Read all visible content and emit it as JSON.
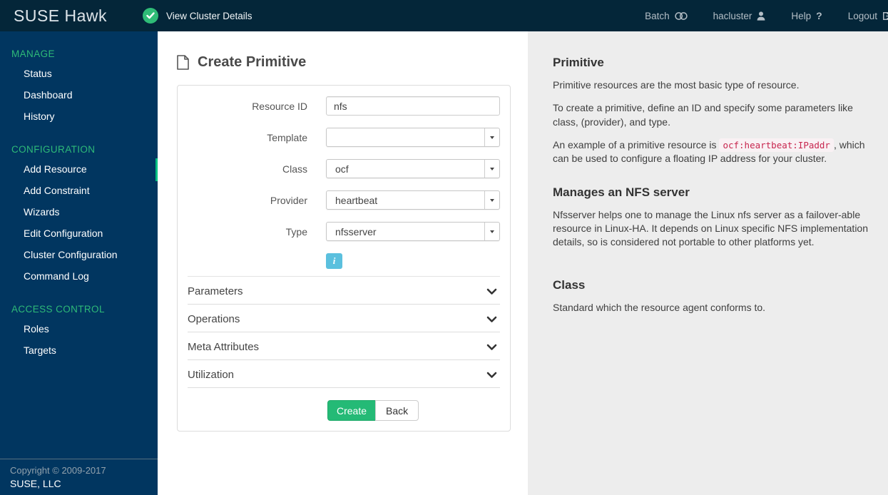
{
  "topbar": {
    "brand": "SUSE Hawk",
    "cluster_status_label": "View Cluster Details",
    "batch_label": "Batch",
    "user_label": "hacluster",
    "help_label": "Help",
    "logout_label": "Logout"
  },
  "sidebar": {
    "sections": [
      {
        "header": "MANAGE",
        "items": [
          {
            "label": "Status"
          },
          {
            "label": "Dashboard"
          },
          {
            "label": "History"
          }
        ]
      },
      {
        "header": "CONFIGURATION",
        "items": [
          {
            "label": "Add Resource",
            "active": true
          },
          {
            "label": "Add Constraint"
          },
          {
            "label": "Wizards"
          },
          {
            "label": "Edit Configuration"
          },
          {
            "label": "Cluster Configuration"
          },
          {
            "label": "Command Log"
          }
        ]
      },
      {
        "header": "ACCESS CONTROL",
        "items": [
          {
            "label": "Roles"
          },
          {
            "label": "Targets"
          }
        ]
      }
    ],
    "copyright": "Copyright © 2009-2017",
    "company": "SUSE, LLC"
  },
  "main": {
    "title": "Create Primitive",
    "fields": [
      {
        "label": "Resource ID",
        "control": "text",
        "value": "nfs"
      },
      {
        "label": "Template",
        "control": "select",
        "value": ""
      },
      {
        "label": "Class",
        "control": "select",
        "value": "ocf"
      },
      {
        "label": "Provider",
        "control": "select",
        "value": "heartbeat"
      },
      {
        "label": "Type",
        "control": "select",
        "value": "nfsserver"
      }
    ],
    "accordions": [
      {
        "label": "Parameters"
      },
      {
        "label": "Operations"
      },
      {
        "label": "Meta Attributes"
      },
      {
        "label": "Utilization"
      }
    ],
    "create_label": "Create",
    "back_label": "Back"
  },
  "help_panel": {
    "primitive": {
      "title": "Primitive",
      "p1": "Primitive resources are the most basic type of resource.",
      "p2": "To create a primitive, define an ID and specify some parameters like class, (provider), and type.",
      "p3_before": "An example of a primitive resource is ",
      "p3_code": "ocf:heartbeat:IPaddr",
      "p3_after": ", which can be used to configure a floating IP address for your cluster."
    },
    "agent": {
      "title": "Manages an NFS server",
      "body": "Nfsserver helps one to manage the Linux nfs server as a failover-able resource in Linux-HA. It depends on Linux specific NFS implementation details, so is considered not portable to other platforms yet."
    },
    "class": {
      "title": "Class",
      "body": "Standard which the resource agent conforms to."
    }
  },
  "icons": {
    "status": "check-circle",
    "batch": "batch-toggle-circles",
    "user": "user-silhouette",
    "help": "question-mark",
    "logout": "sign-out",
    "page": "document-outline",
    "info": "info",
    "accordion": "chevron-down",
    "select": "caret-down"
  },
  "colors": {
    "topbar_bg": "#042639",
    "sidebar_bg": "#013660",
    "accent_green": "#2eba78",
    "active_indicator": "#00c081",
    "create_button": "#24ba76",
    "info_button": "#5bc0de",
    "code_text": "#c7254e",
    "help_panel_bg": "#ededed"
  }
}
